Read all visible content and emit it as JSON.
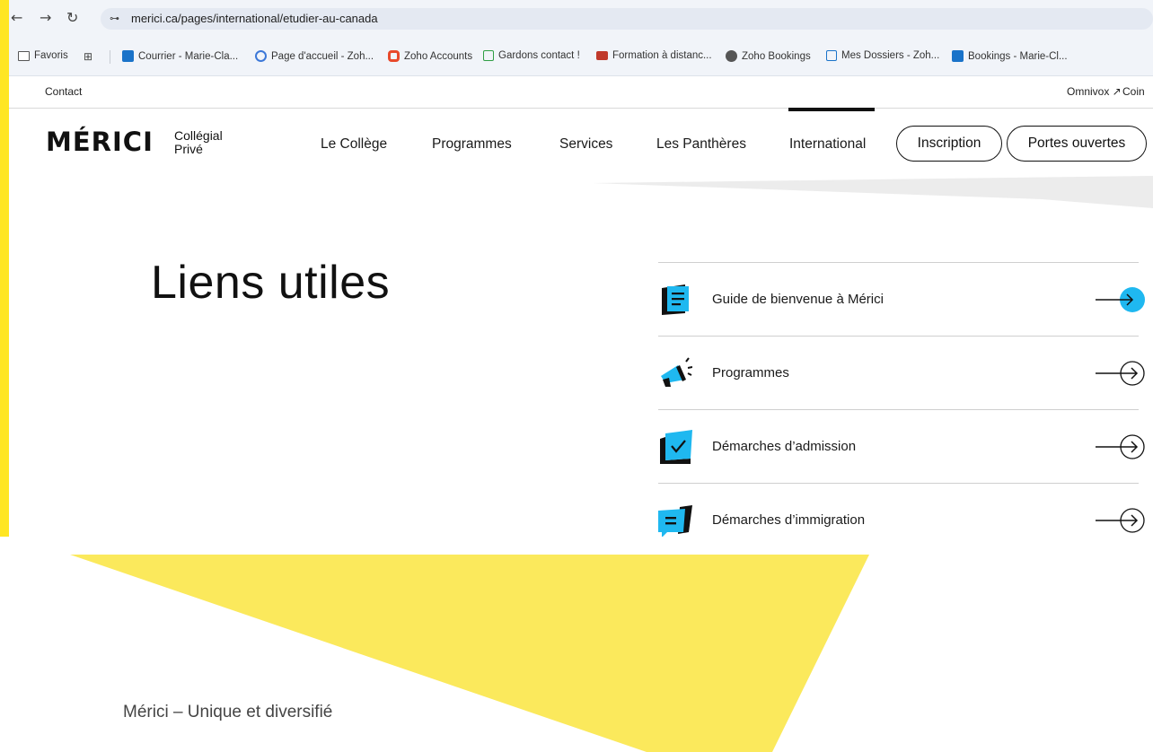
{
  "browser": {
    "url": "merici.ca/pages/international/etudier-au-canada",
    "bookmarks": [
      {
        "label": "Favoris",
        "icon": "folder-icon"
      },
      {
        "label": "Courrier - Marie-Cla...",
        "icon": "outlook-icon"
      },
      {
        "label": "Page d'accueil - Zoh...",
        "icon": "zoho-icon"
      },
      {
        "label": "Zoho Accounts",
        "icon": "zoho-accounts-icon"
      },
      {
        "label": "Gardons contact !",
        "icon": "forms-icon"
      },
      {
        "label": "Formation à distanc...",
        "icon": "formation-icon"
      },
      {
        "label": "Zoho Bookings",
        "icon": "globe-icon"
      },
      {
        "label": "Mes Dossiers - Zoh...",
        "icon": "dossiers-icon"
      },
      {
        "label": "Bookings - Marie-Cl...",
        "icon": "bookings-icon"
      }
    ]
  },
  "site": {
    "utility": {
      "contact": "Contact",
      "omnivox": "Omnivox ↗",
      "coin": "Coin"
    },
    "logo": {
      "name": "MÉRICI",
      "sub1": "Collégial",
      "sub2": "Privé"
    },
    "nav": [
      "Le Collège",
      "Programmes",
      "Services",
      "Les Panthères",
      "International"
    ],
    "active_nav": "International",
    "buttons": {
      "inscription": "Inscription",
      "portes": "Portes ouvertes"
    },
    "heading": "Liens utiles",
    "links": [
      {
        "label": "Guide de bienvenue à Mérici",
        "icon": "document-icon",
        "hover": true
      },
      {
        "label": "Programmes",
        "icon": "megaphone-icon",
        "hover": false
      },
      {
        "label": "Démarches d’admission",
        "icon": "checkbox-icon",
        "hover": false
      },
      {
        "label": "Démarches d’immigration",
        "icon": "chat-bubble-icon",
        "hover": false
      }
    ]
  },
  "caption": "Mérici – Unique et diversifié",
  "colors": {
    "accent_blue": "#1fb8f0",
    "slide_yellow": "#fbe95c",
    "slide_yellow_bar": "#ffe623"
  }
}
